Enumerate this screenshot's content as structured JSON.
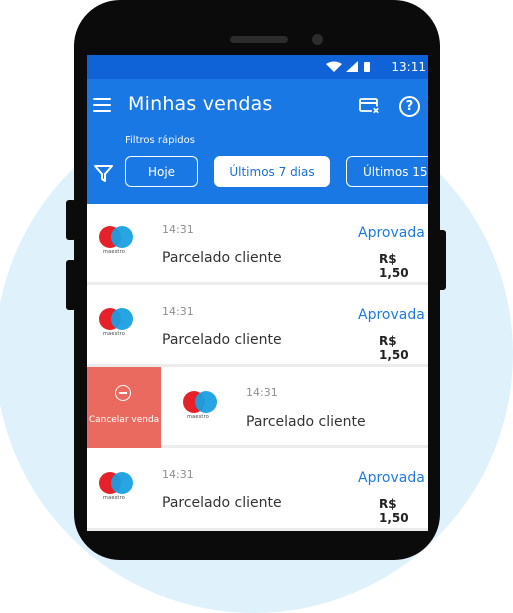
{
  "statusbar": {
    "time": "13:11"
  },
  "header": {
    "title": "Minhas vendas",
    "help_label": "?",
    "filters_label": "Filtros rápidos",
    "chips": [
      {
        "label": "Hoje",
        "selected": false
      },
      {
        "label": "Últimos 7 dias",
        "selected": true
      },
      {
        "label": "Últimos 15",
        "selected": false
      }
    ]
  },
  "sales": [
    {
      "time": "14:31",
      "description": "Parcelado cliente",
      "status": "Aprovada",
      "amount": "R$ 1,50",
      "brand": "maestro"
    },
    {
      "time": "14:31",
      "description": "Parcelado cliente",
      "status": "Aprovada",
      "amount": "R$ 1,50",
      "brand": "maestro"
    },
    {
      "time": "14:31",
      "description": "Parcelado cliente",
      "status": "",
      "amount": "",
      "brand": "maestro"
    },
    {
      "time": "14:31",
      "description": "Parcelado cliente",
      "status": "Aprovada",
      "amount": "R$ 1,50",
      "brand": "maestro"
    }
  ],
  "swipe_action": {
    "label": "Cancelar venda"
  },
  "colors": {
    "primary": "#1a78e5",
    "status_bar": "#0f63d6",
    "approved": "#1f7ae0",
    "cancel": "#ea6a5f",
    "background_circle": "#dff1fb"
  }
}
